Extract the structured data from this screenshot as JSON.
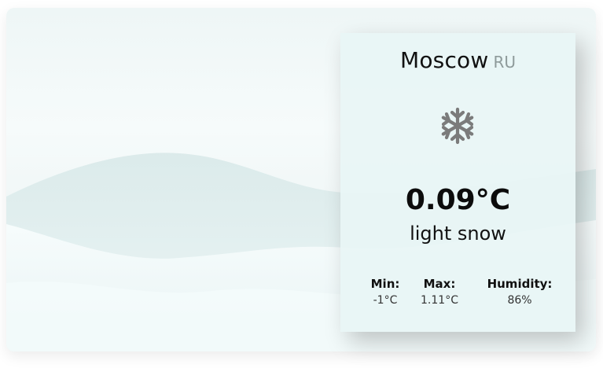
{
  "weather": {
    "city": "Moscow",
    "country": "RU",
    "icon": "snowflake-icon",
    "temperature": "0.09°C",
    "description": "light snow",
    "stats": {
      "min_label": "Min:",
      "min_value": "-1°C",
      "max_label": "Max:",
      "max_value": "1.11°C",
      "humidity_label": "Humidity:",
      "humidity_value": "86%"
    }
  },
  "colors": {
    "card_background": "#e8f5f5",
    "icon": "#7b7b7b",
    "text": "#111111",
    "country_text": "#8e9a9a"
  }
}
